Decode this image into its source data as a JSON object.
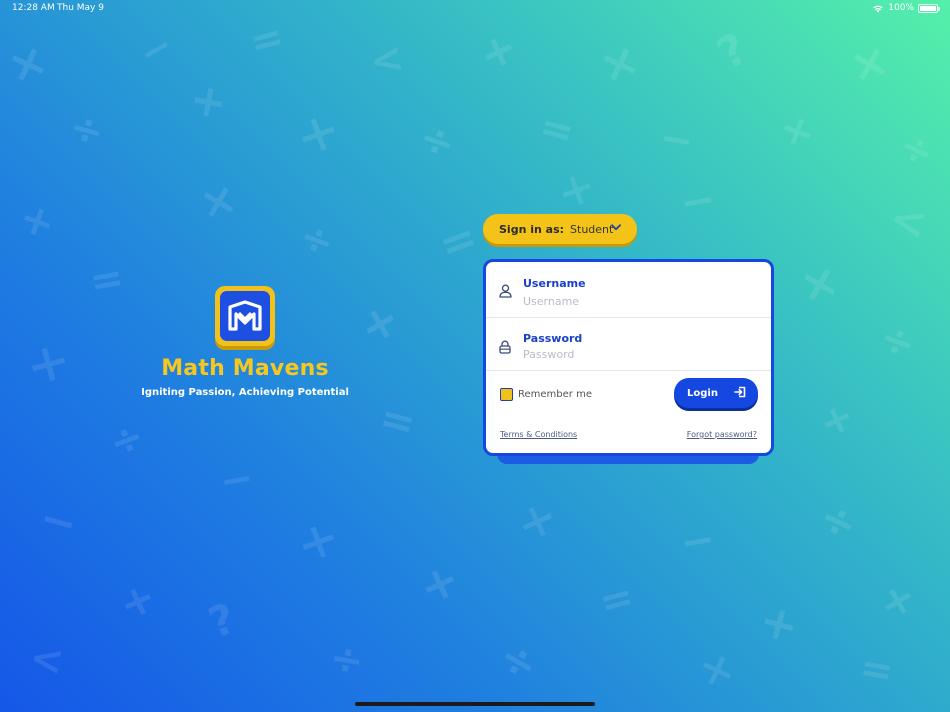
{
  "status_bar": {
    "time": "12:28 AM",
    "date": "Thu May 9",
    "battery": "100%",
    "battery_level": 1.0
  },
  "brand": {
    "app_name": "Math Mavens",
    "tagline": "Igniting Passion, Achieving Potential",
    "logo_icon": "math-mavens-logo-icon"
  },
  "role_selector": {
    "label": "Sign in as:",
    "value": "Student",
    "icon": "chevron-down-icon"
  },
  "login_form": {
    "username": {
      "label": "Username",
      "placeholder": "Username",
      "value": "",
      "icon": "user-icon"
    },
    "password": {
      "label": "Password",
      "placeholder": "Password",
      "value": "",
      "icon": "lock-icon"
    },
    "remember_me": {
      "label": "Remember me",
      "checked": false
    },
    "login_button": {
      "label": "Login",
      "icon": "login-arrow-icon"
    },
    "terms_link": "Terms & Conditions",
    "forgot_link": "Forgot password?"
  },
  "colors": {
    "primary_blue": "#1448e0",
    "accent_yellow": "#f3c417",
    "brand_text": "#f6c81f",
    "gradient_start": "#1557e8",
    "gradient_end": "#55f0aa"
  }
}
